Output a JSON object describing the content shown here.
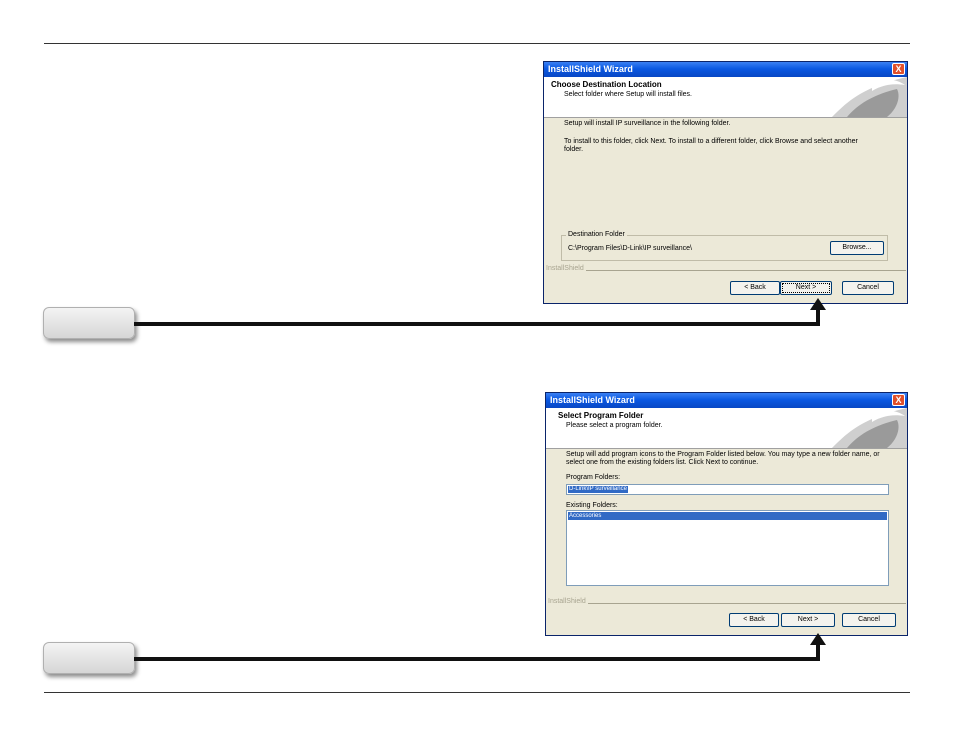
{
  "dialog1": {
    "title": "InstallShield Wizard",
    "close": "X",
    "header_title": "Choose Destination Location",
    "header_subtitle": "Select folder where Setup will install files.",
    "line1": "Setup will install IP surveillance in the following folder.",
    "line2": "To install to this folder, click Next. To install to a different folder, click Browse and select another folder.",
    "group_label": "Destination Folder",
    "path": "C:\\Program Files\\D-Link\\IP surveillance\\",
    "browse": "Browse...",
    "footer_label": "InstallShield",
    "back": "< Back",
    "next": "Next >",
    "cancel": "Cancel"
  },
  "dialog2": {
    "title": "InstallShield Wizard",
    "close": "X",
    "header_title": "Select Program Folder",
    "header_subtitle": "Please select a program folder.",
    "line1": "Setup will add program icons to the Program Folder listed below.  You may type a new folder name, or select one from the existing folders list.  Click Next to continue.",
    "program_label": "Program Folders:",
    "program_value": "D-Link\\IP surveillance",
    "existing_label": "Existing Folders:",
    "existing_items": [
      "Accessories"
    ],
    "footer_label": "InstallShield",
    "back": "< Back",
    "next": "Next >",
    "cancel": "Cancel"
  },
  "colors": {
    "titlebar": "#0a58e2",
    "dialog_bg": "#ece9d8",
    "selection": "#316ac5"
  }
}
